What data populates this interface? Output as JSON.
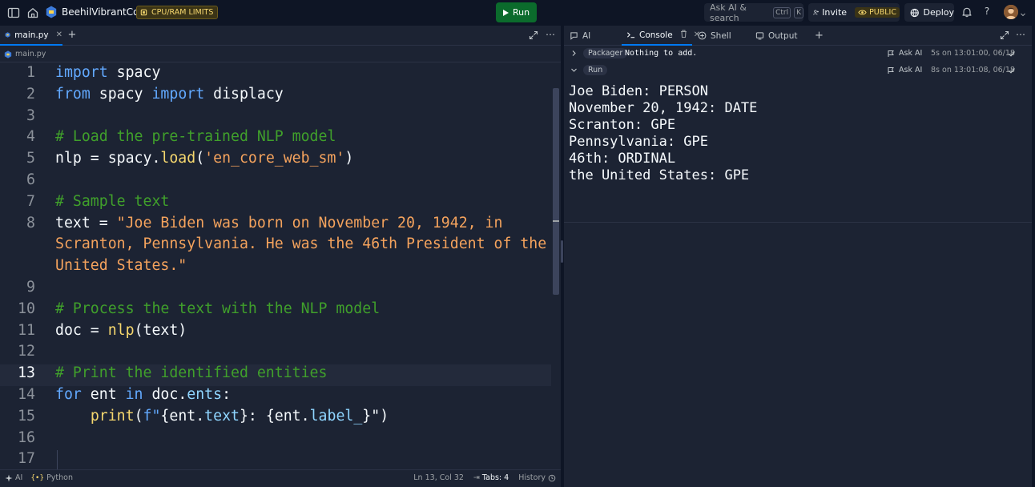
{
  "topbar": {
    "repl_name": "BeehilVibrantCode",
    "limits_label": "CPU/RAM LIMITS",
    "run_label": "Run",
    "search_placeholder": "Ask AI & search",
    "search_kbd_1": "Ctrl",
    "search_kbd_2": "K",
    "invite_label": "Invite",
    "visibility_label": "PUBLIC",
    "deploy_label": "Deploy",
    "help_label": "?"
  },
  "editor": {
    "tab_label": "main.py",
    "breadcrumb": "main.py",
    "active_line": 13,
    "lines": [
      {
        "n": "1"
      },
      {
        "n": "2"
      },
      {
        "n": "3"
      },
      {
        "n": "4"
      },
      {
        "n": "5"
      },
      {
        "n": "6"
      },
      {
        "n": "7"
      },
      {
        "n": "8"
      },
      {
        "n": "9"
      },
      {
        "n": "10"
      },
      {
        "n": "11"
      },
      {
        "n": "12"
      },
      {
        "n": "13"
      },
      {
        "n": "14"
      },
      {
        "n": "15"
      },
      {
        "n": "16"
      },
      {
        "n": "17"
      }
    ],
    "code": {
      "l1_kw": "import",
      "l1_rest": " spacy",
      "l2_kw1": "from",
      "l2_mid": " spacy ",
      "l2_kw2": "import",
      "l2_rest": " displacy",
      "l4": "# Load the pre-trained NLP model",
      "l5_a": "nlp = spacy.",
      "l5_fn": "load",
      "l5_b": "(",
      "l5_str": "'en_core_web_sm'",
      "l5_c": ")",
      "l7": "# Sample text",
      "l8_a": "text = ",
      "l8_str": "\"Joe Biden was born on November 20, 1942, in",
      "l8_wrap1": "Scranton, Pennsylvania. He was the 46th President of the",
      "l8_wrap2": "United States.\"",
      "l10": "# Process the text with the NLP model",
      "l11_a": "doc = ",
      "l11_fn": "nlp",
      "l11_b": "(text)",
      "l13": "# Print the identified entities",
      "l14_kw1": "for",
      "l14_a": " ent ",
      "l14_kw2": "in",
      "l14_b": " doc.",
      "l14_attr": "ents",
      "l14_c": ":",
      "l15_indent": "    ",
      "l15_fn": "print",
      "l15_a": "(",
      "l15_f": "f\"",
      "l15_b": "{ent.",
      "l15_attr1": "text",
      "l15_c": "}: {ent.",
      "l15_attr2": "label_",
      "l15_d": "}\")"
    }
  },
  "statusbar": {
    "ai_label": "AI",
    "language": "Python",
    "cursor": "Ln 13, Col 32",
    "tabs": "Tabs: 4",
    "history": "History"
  },
  "panel": {
    "tabs": [
      {
        "label": "AI"
      },
      {
        "label": "Console"
      },
      {
        "label": "Shell"
      },
      {
        "label": "Output"
      }
    ],
    "logs": [
      {
        "tag": "Packager",
        "message": "Nothing to add.",
        "ask": "Ask AI",
        "time": "5s on 13:01:00, 06/18"
      },
      {
        "tag": "Run",
        "message": "",
        "ask": "Ask AI",
        "time": "8s on 13:01:08, 06/18"
      }
    ],
    "output": "Joe Biden: PERSON\nNovember 20, 1942: DATE\nScranton: GPE\nPennsylvania: GPE\n46th: ORDINAL\nthe United States: GPE"
  },
  "colors": {
    "background": "#0e1525",
    "surface": "#1c2333",
    "accent": "#0079f2",
    "run_green": "#0b6b2c",
    "badge_yellow": "#f5d76e",
    "keyword": "#62a9ff",
    "comment": "#40a02b",
    "string": "#f5a35d"
  }
}
